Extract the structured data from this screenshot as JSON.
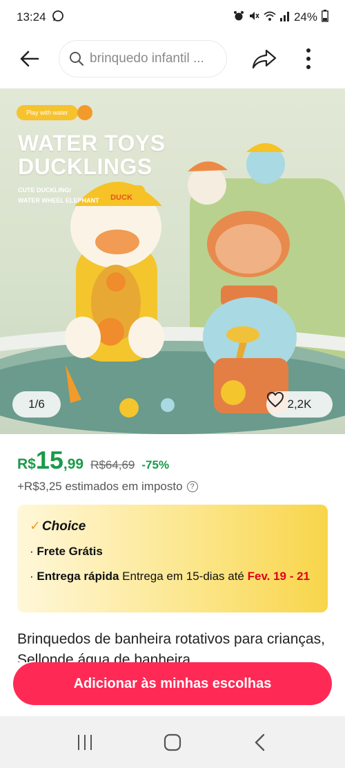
{
  "status_bar": {
    "time": "13:24",
    "battery": "24%"
  },
  "header": {
    "search_value": "brinquedo infantil ..."
  },
  "gallery": {
    "promo_pill": "Play with water",
    "promo_title": "WATER TOYS DUCKLINGS",
    "promo_subtitle_1": "CUTE DUCKLING/",
    "promo_subtitle_2": "WATER WHEEL ELEPHANT",
    "duck_cap_label": "DUCK",
    "page_counter": "1/6",
    "likes": "2,2K"
  },
  "pricing": {
    "currency": "R$",
    "price_int": "15",
    "price_dec": ",99",
    "original_price": "R$64,69",
    "discount": "-75%",
    "tax_note": "+R$3,25 estimados em imposto",
    "help_symbol": "?"
  },
  "choice": {
    "brand": "Choice",
    "shipping_label": "Frete Grátis",
    "delivery_bold": "Entrega rápida",
    "delivery_text": " Entrega em 15-dias até ",
    "delivery_deadline": "Fev. 19 - 21"
  },
  "product": {
    "title": "Brinquedos de banheira rotativos para crianças, Sellonde água de banheira"
  },
  "cta": {
    "label": "Adicionar às minhas escolhas"
  },
  "colors": {
    "price_green": "#1a9a4a",
    "cta_red": "#fe2a55",
    "deadline_red": "#e0001b",
    "choice_gold": "#f8d54a"
  },
  "icons": [
    "whatsapp-icon",
    "alarm-icon",
    "mute-icon",
    "wifi-icon",
    "signal-icon",
    "battery-icon",
    "back-arrow-icon",
    "search-icon",
    "share-icon",
    "more-vertical-icon",
    "heart-icon",
    "help-circle-icon",
    "checkmark-icon",
    "recent-apps-icon",
    "home-icon",
    "back-nav-icon"
  ]
}
